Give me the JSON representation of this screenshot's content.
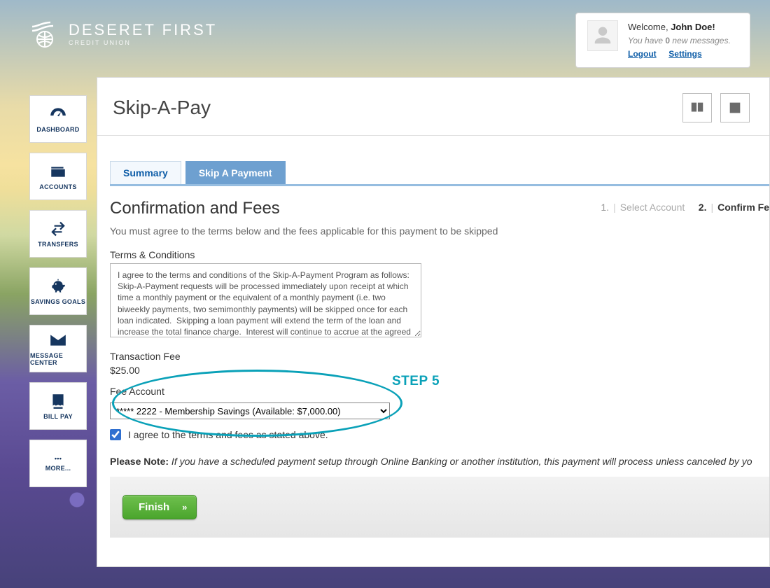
{
  "brand": {
    "name": "DESERET FIRST",
    "sub": "CREDIT UNION"
  },
  "welcome": {
    "greeting": "Welcome,",
    "user": "John Doe!",
    "msg_prefix": "You have",
    "msg_count": "0",
    "msg_suffix": "new messages.",
    "logout": "Logout",
    "settings": "Settings"
  },
  "nav": {
    "dashboard": "DASHBOARD",
    "accounts": "ACCOUNTS",
    "transfers": "TRANSFERS",
    "savings": "SAVINGS GOALS",
    "messages": "MESSAGE CENTER",
    "billpay": "BILL PAY",
    "more": "MORE..."
  },
  "page": {
    "title": "Skip-A-Pay"
  },
  "tabs": {
    "summary": "Summary",
    "skip": "Skip A Payment"
  },
  "steps": {
    "n1": "1.",
    "s1": "Select Account",
    "n2": "2.",
    "s2": "Confirm Fe"
  },
  "form": {
    "heading": "Confirmation and Fees",
    "sub": "You must agree to the terms below and the fees applicable for this payment to be skipped",
    "terms_label": "Terms & Conditions",
    "terms_text": "I agree to the terms and conditions of the Skip-A-Payment Program as follows: Skip-A-Payment requests will be processed immediately upon receipt at which time a monthly payment or the equivalent of a monthly payment (i.e. two biweekly payments, two semimonthly payments) will be skipped once for each loan indicated.  Skipping a loan payment will extend the term of the loan and increase the total finance charge.  Interest will continue to accrue at the agreed rate.",
    "fee_label": "Transaction Fee",
    "fee_amount": "$25.00",
    "acct_label": "Fee Account",
    "acct_value": "***** 2222  - Membership Savings (Available: $7,000.00)",
    "agree": "I agree to the terms and fees as stated above.",
    "note_bold": "Please Note:",
    "note_text": " If you have a scheduled payment setup through Online Banking or another institution, this payment will process unless canceled by yo",
    "finish": "Finish"
  },
  "annotation": {
    "step": "STEP 5"
  }
}
